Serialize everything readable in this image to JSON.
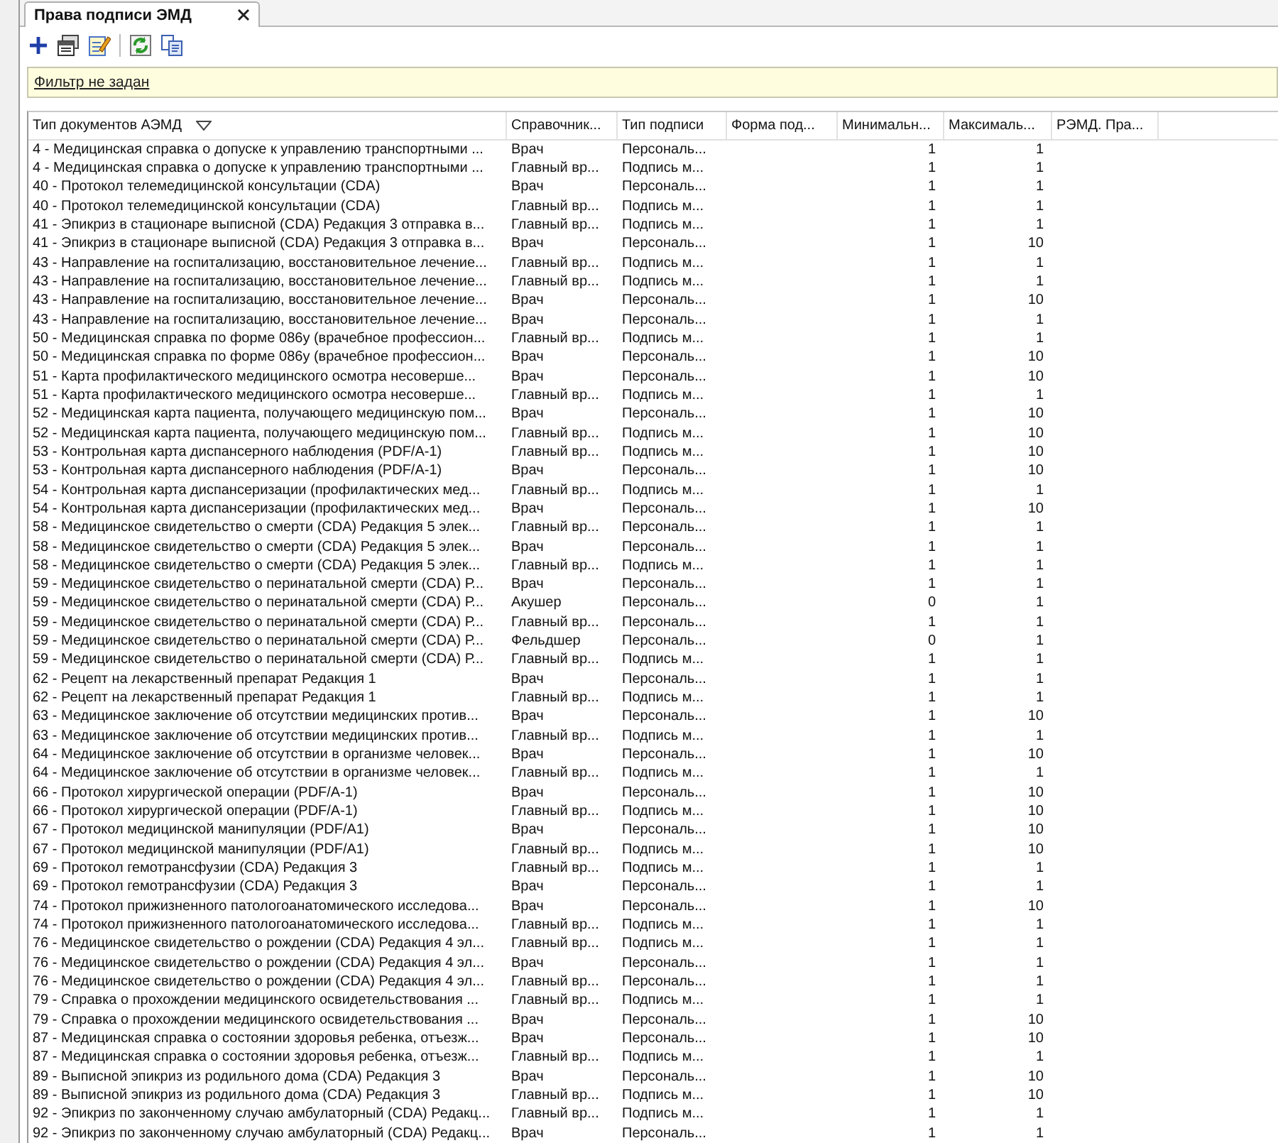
{
  "tab": {
    "label": "Права подписи ЭМД",
    "selected": true
  },
  "toolbar": [
    {
      "kind": "add"
    },
    {
      "kind": "properties"
    },
    {
      "kind": "edit"
    },
    {
      "kind": "separator"
    },
    {
      "kind": "refresh"
    },
    {
      "kind": "export"
    }
  ],
  "filter": {
    "link": "Фильтр не задан"
  },
  "table": {
    "columns": [
      {
        "label": "Тип документов АЭМД",
        "sorted": true
      },
      {
        "label": "Справочник..."
      },
      {
        "label": "Тип подписи"
      },
      {
        "label": "Форма под..."
      },
      {
        "label": "Минимальн..."
      },
      {
        "label": "Максималь..."
      },
      {
        "label": "РЭМД. Пра..."
      }
    ],
    "rows": [
      [
        "4 - Медицинская справка о допуске к управлению транспортными ...",
        "Врач",
        "Персональ...",
        "",
        "1",
        "1"
      ],
      [
        "4 - Медицинская справка о допуске к управлению транспортными ...",
        "Главный вр...",
        "Подпись м...",
        "",
        "1",
        "1"
      ],
      [
        "40 - Протокол телемедицинской консультации (CDA)",
        "Врач",
        "Персональ...",
        "",
        "1",
        "1"
      ],
      [
        "40 - Протокол телемедицинской консультации (CDA)",
        "Главный вр...",
        "Подпись м...",
        "",
        "1",
        "1"
      ],
      [
        "41 - Эпикриз в стационаре выписной (CDA) Редакция 3 отправка в...",
        "Главный вр...",
        "Подпись м...",
        "",
        "1",
        "1"
      ],
      [
        "41 - Эпикриз в стационаре выписной (CDA) Редакция 3 отправка в...",
        "Врач",
        "Персональ...",
        "",
        "1",
        "10"
      ],
      [
        "43 - Направление на госпитализацию, восстановительное лечение...",
        "Главный вр...",
        "Подпись м...",
        "",
        "1",
        "1"
      ],
      [
        "43 - Направление на госпитализацию, восстановительное лечение...",
        "Главный вр...",
        "Подпись м...",
        "",
        "1",
        "1"
      ],
      [
        "43 - Направление на госпитализацию, восстановительное лечение...",
        "Врач",
        "Персональ...",
        "",
        "1",
        "10"
      ],
      [
        "43 - Направление на госпитализацию, восстановительное лечение...",
        "Врач",
        "Персональ...",
        "",
        "1",
        "1"
      ],
      [
        "50 - Медицинская справка по форме 086у (врачебное профессион...",
        "Главный вр...",
        "Подпись м...",
        "",
        "1",
        "1"
      ],
      [
        "50 - Медицинская справка по форме 086у (врачебное профессион...",
        "Врач",
        "Персональ...",
        "",
        "1",
        "10"
      ],
      [
        "51 - Карта профилактического медицинского осмотра несоверше...",
        "Врач",
        "Персональ...",
        "",
        "1",
        "10"
      ],
      [
        "51 - Карта профилактического медицинского осмотра несоверше...",
        "Главный вр...",
        "Подпись м...",
        "",
        "1",
        "1"
      ],
      [
        "52 - Медицинская карта пациента, получающего медицинскую пом...",
        "Врач",
        "Персональ...",
        "",
        "1",
        "10"
      ],
      [
        "52 - Медицинская карта пациента, получающего медицинскую пом...",
        "Главный вр...",
        "Подпись м...",
        "",
        "1",
        "10"
      ],
      [
        "53 - Контрольная карта диспансерного наблюдения (PDF/A-1)",
        "Главный вр...",
        "Подпись м...",
        "",
        "1",
        "10"
      ],
      [
        "53 - Контрольная карта диспансерного наблюдения (PDF/A-1)",
        "Врач",
        "Персональ...",
        "",
        "1",
        "10"
      ],
      [
        "54 - Контрольная карта диспансеризации (профилактических мед...",
        "Главный вр...",
        "Подпись м...",
        "",
        "1",
        "1"
      ],
      [
        "54 - Контрольная карта диспансеризации (профилактических мед...",
        "Врач",
        "Персональ...",
        "",
        "1",
        "10"
      ],
      [
        "58 - Медицинское свидетельство о смерти (CDA) Редакция 5 элек...",
        "Главный вр...",
        "Персональ...",
        "",
        "1",
        "1"
      ],
      [
        "58 - Медицинское свидетельство о смерти (CDA) Редакция 5 элек...",
        "Врач",
        "Персональ...",
        "",
        "1",
        "1"
      ],
      [
        "58 - Медицинское свидетельство о смерти (CDA) Редакция 5 элек...",
        "Главный вр...",
        "Подпись м...",
        "",
        "1",
        "1"
      ],
      [
        "59 - Медицинское свидетельство о перинатальной смерти (CDA) Р...",
        "Врач",
        "Персональ...",
        "",
        "1",
        "1"
      ],
      [
        "59 - Медицинское свидетельство о перинатальной смерти (CDA) Р...",
        "Акушер",
        "Персональ...",
        "",
        "0",
        "1"
      ],
      [
        "59 - Медицинское свидетельство о перинатальной смерти (CDA) Р...",
        "Главный вр...",
        "Персональ...",
        "",
        "1",
        "1"
      ],
      [
        "59 - Медицинское свидетельство о перинатальной смерти (CDA) Р...",
        "Фельдшер",
        "Персональ...",
        "",
        "0",
        "1"
      ],
      [
        "59 - Медицинское свидетельство о перинатальной смерти (CDA) Р...",
        "Главный вр...",
        "Подпись м...",
        "",
        "1",
        "1"
      ],
      [
        "62 - Рецепт на лекарственный препарат Редакция 1",
        "Врач",
        "Персональ...",
        "",
        "1",
        "1"
      ],
      [
        "62 - Рецепт на лекарственный препарат Редакция 1",
        "Главный вр...",
        "Подпись м...",
        "",
        "1",
        "1"
      ],
      [
        "63 - Медицинское заключение об отсутствии медицинских против...",
        "Врач",
        "Персональ...",
        "",
        "1",
        "10"
      ],
      [
        "63 - Медицинское заключение об отсутствии медицинских против...",
        "Главный вр...",
        "Подпись м...",
        "",
        "1",
        "1"
      ],
      [
        "64 - Медицинское заключение об отсутствии в организме человек...",
        "Врач",
        "Персональ...",
        "",
        "1",
        "10"
      ],
      [
        "64 - Медицинское заключение об отсутствии в организме человек...",
        "Главный вр...",
        "Подпись м...",
        "",
        "1",
        "1"
      ],
      [
        "66 - Протокол хирургической операции (PDF/A-1)",
        "Врач",
        "Персональ...",
        "",
        "1",
        "10"
      ],
      [
        "66 - Протокол хирургической операции (PDF/A-1)",
        "Главный вр...",
        "Подпись м...",
        "",
        "1",
        "10"
      ],
      [
        "67 - Протокол медицинской манипуляции (PDF/A1)",
        "Врач",
        "Персональ...",
        "",
        "1",
        "10"
      ],
      [
        "67 - Протокол медицинской манипуляции (PDF/A1)",
        "Главный вр...",
        "Подпись м...",
        "",
        "1",
        "10"
      ],
      [
        "69 - Протокол гемотрансфузии (CDA) Редакция 3",
        "Главный вр...",
        "Подпись м...",
        "",
        "1",
        "1"
      ],
      [
        "69 - Протокол гемотрансфузии (CDA) Редакция 3",
        "Врач",
        "Персональ...",
        "",
        "1",
        "1"
      ],
      [
        "74 - Протокол прижизненного патологоанатомического исследова...",
        "Врач",
        "Персональ...",
        "",
        "1",
        "10"
      ],
      [
        "74 - Протокол прижизненного патологоанатомического исследова...",
        "Главный вр...",
        "Подпись м...",
        "",
        "1",
        "1"
      ],
      [
        "76 - Медицинское свидетельство о рождении (CDA) Редакция 4 эл...",
        "Главный вр...",
        "Подпись м...",
        "",
        "1",
        "1"
      ],
      [
        "76 - Медицинское свидетельство о рождении (CDA) Редакция 4 эл...",
        "Врач",
        "Персональ...",
        "",
        "1",
        "1"
      ],
      [
        "76 - Медицинское свидетельство о рождении (CDA) Редакция 4 эл...",
        "Главный вр...",
        "Персональ...",
        "",
        "1",
        "1"
      ],
      [
        "79 - Справка о прохождении медицинского освидетельствования ...",
        "Главный вр...",
        "Подпись м...",
        "",
        "1",
        "1"
      ],
      [
        "79 - Справка о прохождении медицинского освидетельствования ...",
        "Врач",
        "Персональ...",
        "",
        "1",
        "10"
      ],
      [
        "87 - Медицинская справка о состоянии здоровья ребенка, отъезж...",
        "Врач",
        "Персональ...",
        "",
        "1",
        "10"
      ],
      [
        "87 - Медицинская справка о состоянии здоровья ребенка, отъезж...",
        "Главный вр...",
        "Подпись м...",
        "",
        "1",
        "1"
      ],
      [
        "89 - Выписной эпикриз из родильного дома (CDA) Редакция 3",
        "Врач",
        "Персональ...",
        "",
        "1",
        "10"
      ],
      [
        "89 - Выписной эпикриз из родильного дома (CDA) Редакция 3",
        "Главный вр...",
        "Подпись м...",
        "",
        "1",
        "10"
      ],
      [
        "92 - Эпикриз по законченному случаю амбулаторный (CDA) Редакц...",
        "Главный вр...",
        "Подпись м...",
        "",
        "1",
        "1"
      ],
      [
        "92 - Эпикриз по законченному случаю амбулаторный (CDA) Редакц...",
        "Врач",
        "Персональ...",
        "",
        "1",
        "1"
      ]
    ]
  }
}
